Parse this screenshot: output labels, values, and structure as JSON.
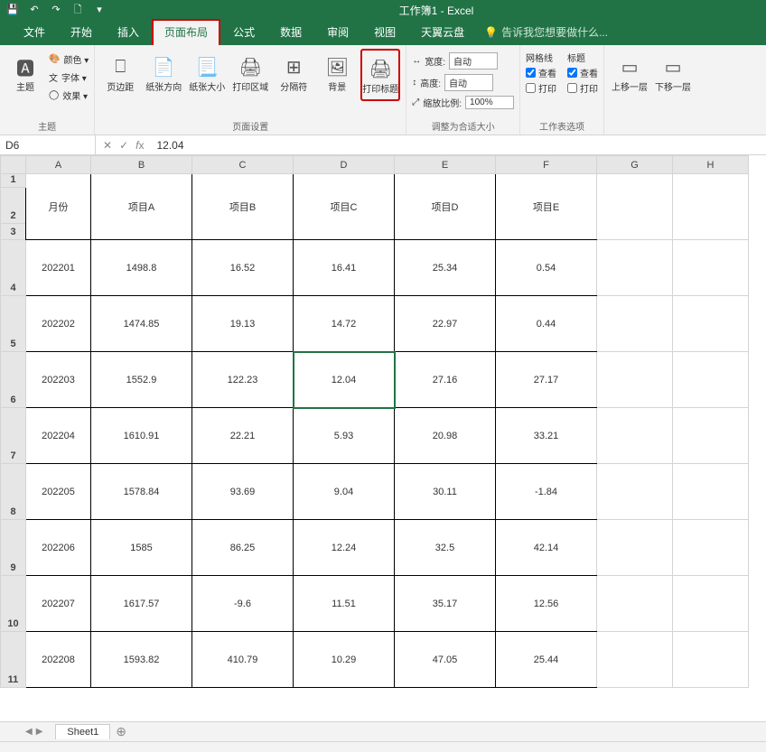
{
  "app_title": "工作簿1 - Excel",
  "qat": {
    "save": "💾",
    "undo": "↶",
    "redo": "↷",
    "new": "🗋"
  },
  "tabs": {
    "file": "文件",
    "home": "开始",
    "insert": "插入",
    "layout": "页面布局",
    "formulas": "公式",
    "data": "数据",
    "review": "审阅",
    "view": "视图",
    "cloud": "天翼云盘",
    "tellme": "告诉我您想要做什么..."
  },
  "ribbon": {
    "themes": {
      "label": "主题",
      "theme_btn": "主题",
      "colors": "颜色 ▾",
      "fonts": "字体 ▾",
      "effects": "效果 ▾"
    },
    "page_setup": {
      "label": "页面设置",
      "margins": "页边距",
      "orientation": "纸张方向",
      "size": "纸张大小",
      "print_area": "打印区域",
      "breaks": "分隔符",
      "background": "背景",
      "print_titles": "打印标题"
    },
    "fit": {
      "label": "调整为合适大小",
      "width_lbl": "宽度:",
      "width_val": "自动",
      "height_lbl": "高度:",
      "height_val": "自动",
      "scale_lbl": "缩放比例:",
      "scale_val": "100%"
    },
    "sheet_opts": {
      "label": "工作表选项",
      "grid": "网格线",
      "head": "标题",
      "view_lbl": "查看",
      "print_lbl": "打印"
    },
    "arrange": {
      "label": "",
      "up": "上移一层",
      "down": "下移一层"
    }
  },
  "name_box": "D6",
  "formula_value": "12.04",
  "columns": [
    "A",
    "B",
    "C",
    "D",
    "E",
    "F",
    "G",
    "H"
  ],
  "col_widths": {
    "row_head": 28,
    "A": 72,
    "B": 112,
    "C": 112,
    "D": 112,
    "E": 112,
    "F": 112,
    "G": 84,
    "H": 84
  },
  "headers": [
    "月份",
    "项目A",
    "项目B",
    "项目C",
    "项目D",
    "项目E"
  ],
  "rows": [
    {
      "n": 4,
      "month": "202201",
      "a": "1498.8",
      "b": "16.52",
      "c": "16.41",
      "d": "25.34",
      "e": "0.54"
    },
    {
      "n": 5,
      "month": "202202",
      "a": "1474.85",
      "b": "19.13",
      "c": "14.72",
      "d": "22.97",
      "e": "0.44"
    },
    {
      "n": 6,
      "month": "202203",
      "a": "1552.9",
      "b": "122.23",
      "c": "12.04",
      "d": "27.16",
      "e": "27.17"
    },
    {
      "n": 7,
      "month": "202204",
      "a": "1610.91",
      "b": "22.21",
      "c": "5.93",
      "d": "20.98",
      "e": "33.21"
    },
    {
      "n": 8,
      "month": "202205",
      "a": "1578.84",
      "b": "93.69",
      "c": "9.04",
      "d": "30.11",
      "e": "-1.84"
    },
    {
      "n": 9,
      "month": "202206",
      "a": "1585",
      "b": "86.25",
      "c": "12.24",
      "d": "32.5",
      "e": "42.14"
    },
    {
      "n": 10,
      "month": "202207",
      "a": "1617.57",
      "b": "-9.6",
      "c": "11.51",
      "d": "35.17",
      "e": "12.56"
    },
    {
      "n": 11,
      "month": "202208",
      "a": "1593.82",
      "b": "410.79",
      "c": "10.29",
      "d": "47.05",
      "e": "25.44"
    }
  ],
  "active_cell": {
    "row": 6,
    "col": "D"
  },
  "sheet_name": "Sheet1"
}
